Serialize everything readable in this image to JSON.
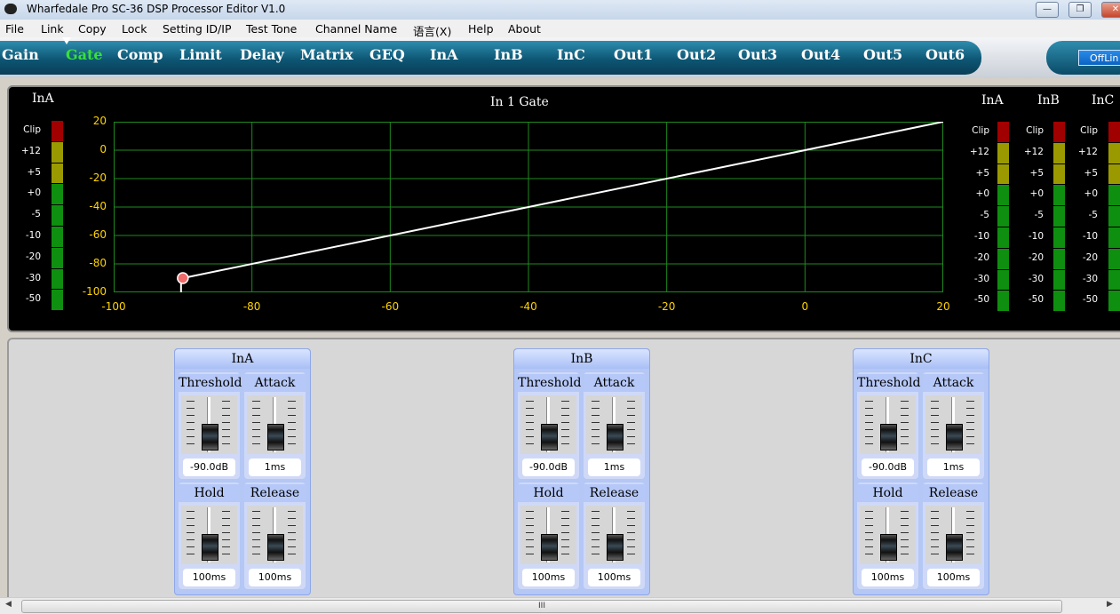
{
  "window": {
    "title": "Wharfedale Pro SC-36 DSP Processor Editor V1.0"
  },
  "menu": [
    "File",
    "Link",
    "Copy",
    "Lock",
    "Setting ID/IP",
    "Test Tone",
    "Channel Name",
    "语言(X)",
    "Help",
    "About"
  ],
  "tabs": [
    {
      "label": "Gain",
      "active": false
    },
    {
      "label": "Gate",
      "active": true
    },
    {
      "label": "Comp",
      "active": false
    },
    {
      "label": "Limit",
      "active": false
    },
    {
      "label": "Delay",
      "active": false
    },
    {
      "label": "Matrix",
      "active": false
    },
    {
      "label": "GEQ",
      "active": false
    },
    {
      "label": "InA",
      "active": false
    },
    {
      "label": "InB",
      "active": false
    },
    {
      "label": "InC",
      "active": false
    },
    {
      "label": "Out1",
      "active": false
    },
    {
      "label": "Out2",
      "active": false
    },
    {
      "label": "Out3",
      "active": false
    },
    {
      "label": "Out4",
      "active": false
    },
    {
      "label": "Out5",
      "active": false
    },
    {
      "label": "Out6",
      "active": false
    }
  ],
  "status": {
    "offline_label": "OffLin"
  },
  "meter_scale": [
    "Clip",
    "+12",
    "+5",
    "+0",
    "-5",
    "-10",
    "-20",
    "-30",
    "-50"
  ],
  "left_meter": {
    "title": "InA"
  },
  "right_meters": [
    {
      "title": "InA"
    },
    {
      "title": "InB"
    },
    {
      "title": "InC"
    }
  ],
  "colors": {
    "clip": "#a00000",
    "hot": "#9a9a00",
    "ok": "#0f8f0f",
    "grid": "#1f8a1f",
    "tick": "#ffd400",
    "accent": "#39e039"
  },
  "graph": {
    "title": "In 1  Gate"
  },
  "chart_data": {
    "type": "line",
    "title": "In 1  Gate",
    "xlim": [
      -100,
      20
    ],
    "ylim": [
      -100,
      20
    ],
    "xticks": [
      -100,
      -80,
      -60,
      -40,
      -20,
      0,
      20
    ],
    "yticks": [
      20,
      0,
      -20,
      -40,
      -60,
      -80,
      -100
    ],
    "grid": true,
    "series": [
      {
        "x": [
          -90,
          20
        ],
        "y": [
          -90,
          20
        ]
      }
    ],
    "gate_threshold_marker": {
      "x": -90,
      "y": -90
    }
  },
  "channels": [
    {
      "name": "InA",
      "threshold_label": "Threshold",
      "threshold": "-90.0dB",
      "attack_label": "Attack",
      "attack": "1ms",
      "hold_label": "Hold",
      "hold": "100ms",
      "release_label": "Release",
      "release": "100ms"
    },
    {
      "name": "InB",
      "threshold_label": "Threshold",
      "threshold": "-90.0dB",
      "attack_label": "Attack",
      "attack": "1ms",
      "hold_label": "Hold",
      "hold": "100ms",
      "release_label": "Release",
      "release": "100ms"
    },
    {
      "name": "InC",
      "threshold_label": "Threshold",
      "threshold": "-90.0dB",
      "attack_label": "Attack",
      "attack": "1ms",
      "hold_label": "Hold",
      "hold": "100ms",
      "release_label": "Release",
      "release": "100ms"
    }
  ],
  "scrollbar": {
    "thumb_glyph": "III"
  }
}
